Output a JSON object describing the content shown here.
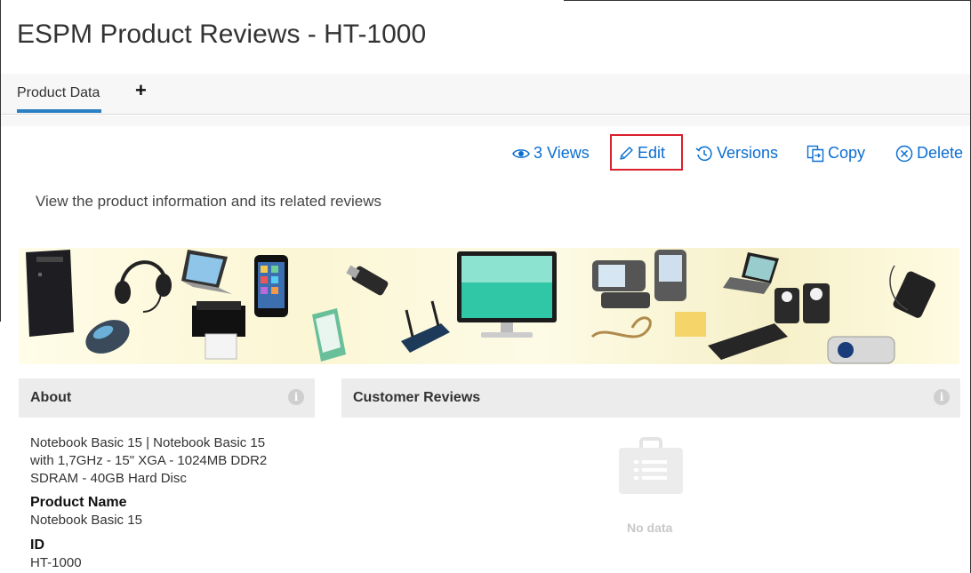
{
  "page": {
    "title": "ESPM Product Reviews - HT-1000"
  },
  "tabs": [
    {
      "label": "Product Data",
      "selected": true
    }
  ],
  "add_tab_label": "+",
  "toolbar": {
    "views_label": "3 Views",
    "edit_label": "Edit",
    "versions_label": "Versions",
    "copy_label": "Copy",
    "delete_label": "Delete",
    "highlighted": "Edit",
    "accent_color": "#0a6ed1",
    "highlight_color": "#d9202c"
  },
  "description": "View the product information and its related reviews",
  "banner": {
    "items": [
      "desktop-tower",
      "mouse",
      "headset",
      "laptop",
      "printer",
      "smartphone",
      "router",
      "usb-drive",
      "monitor",
      "pda",
      "phone",
      "laptop-small",
      "speakers",
      "keyboard",
      "projector",
      "mp3-player"
    ]
  },
  "about": {
    "header": "About",
    "summary_line1": "Notebook Basic 15 | Notebook Basic 15",
    "summary_line2": "with 1,7GHz - 15\" XGA - 1024MB DDR2",
    "summary_line3": "SDRAM - 40GB Hard Disc",
    "product_name_label": "Product Name",
    "product_name_value": "Notebook Basic 15",
    "id_label": "ID",
    "id_value": "HT-1000"
  },
  "reviews": {
    "header": "Customer Reviews",
    "empty_text": "No data"
  },
  "info_glyph": "i"
}
